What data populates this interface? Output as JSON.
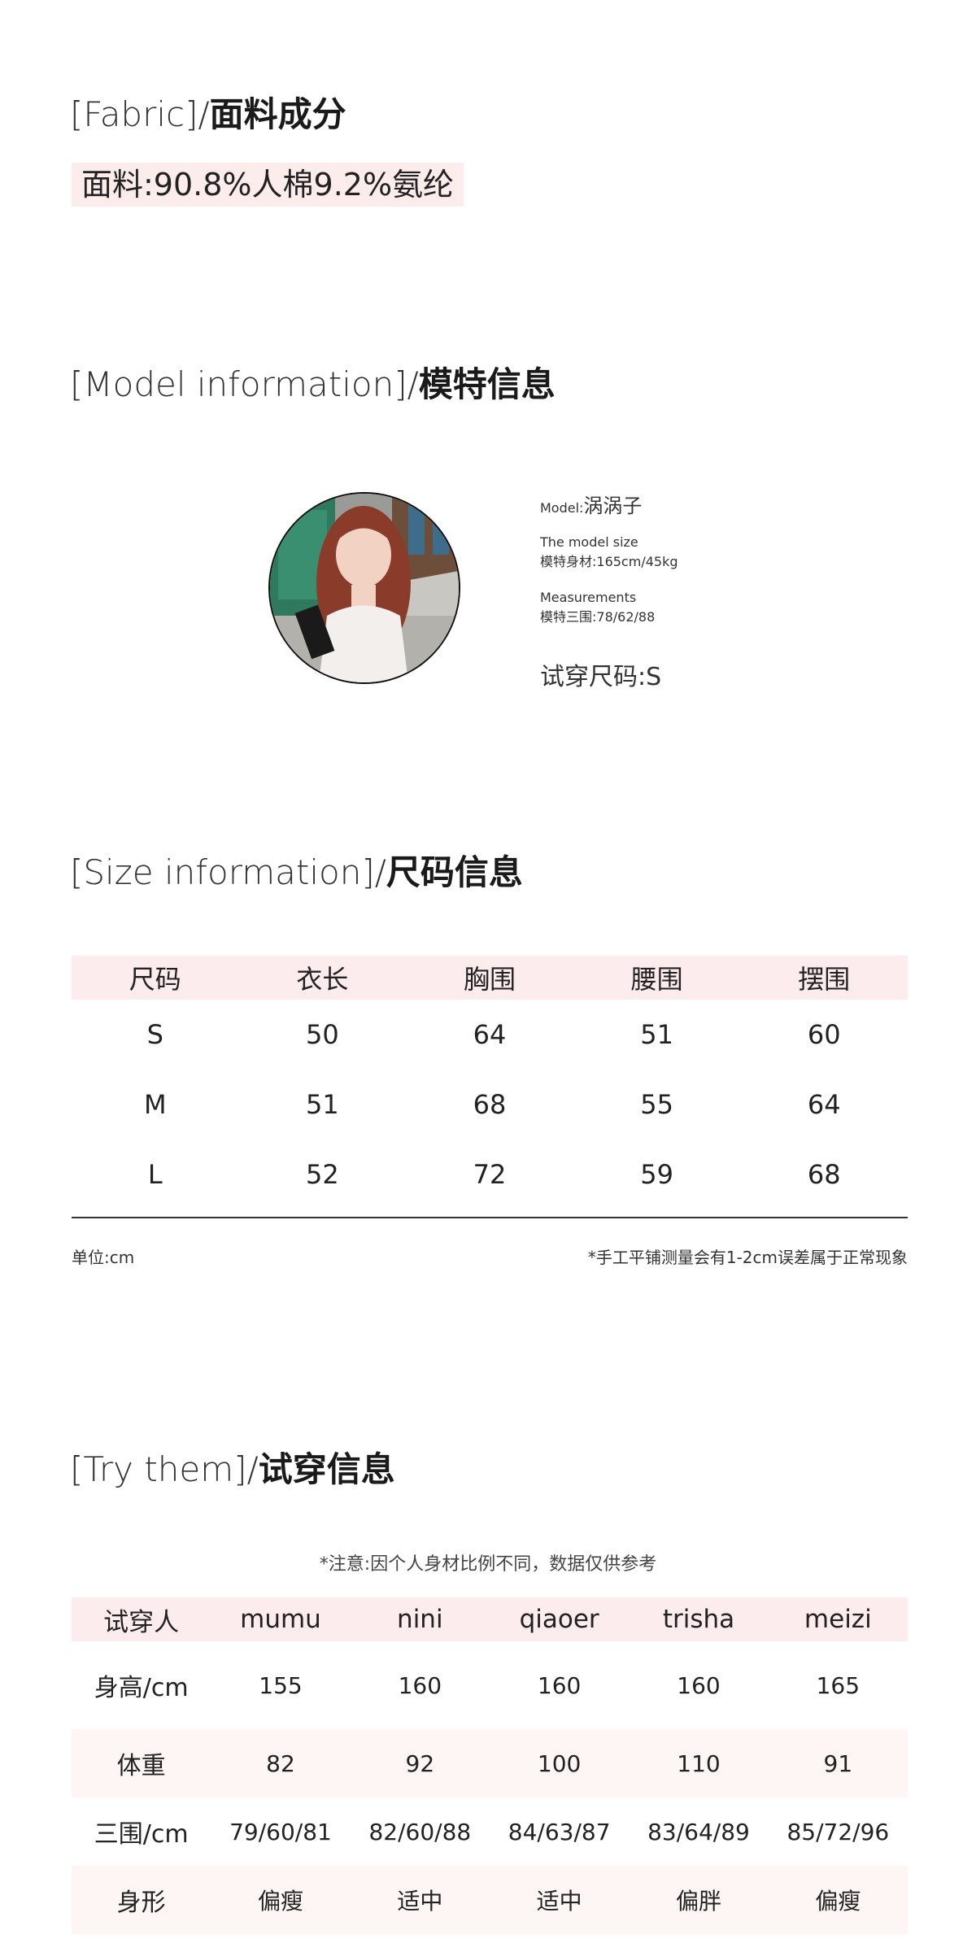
{
  "fabric": {
    "title_en": "[Fabric]/",
    "title_zh": "面料成分",
    "composition": "面料:90.8%人棉9.2%氨纶"
  },
  "model": {
    "title_en": "[Model information]/",
    "title_zh": "模特信息",
    "name_label": "Model:",
    "name": "涡涡子",
    "size_label_en": "The model size",
    "size_value": "模特身材:165cm/45kg",
    "measure_label_en": "Measurements",
    "measure_value": "模特三围:78/62/88",
    "fit_size": "试穿尺码:S"
  },
  "size_info": {
    "title_en": "[Size information]/",
    "title_zh": "尺码信息",
    "headers": [
      "尺码",
      "衣长",
      "胸围",
      "腰围",
      "摆围"
    ],
    "rows": [
      [
        "S",
        "50",
        "64",
        "51",
        "60"
      ],
      [
        "M",
        "51",
        "68",
        "55",
        "64"
      ],
      [
        "L",
        "52",
        "72",
        "59",
        "68"
      ]
    ],
    "unit": "单位:cm",
    "note": "*手工平铺测量会有1-2cm误差属于正常现象"
  },
  "try_info": {
    "title_en": "[Try them]/",
    "title_zh": "试穿信息",
    "note": "*注意:因个人身材比例不同，数据仅供参考",
    "headers": [
      "试穿人",
      "mumu",
      "nini",
      "qiaoer",
      "trisha",
      "meizi"
    ],
    "rows": [
      [
        "身高/cm",
        "155",
        "160",
        "160",
        "160",
        "165"
      ],
      [
        "体重",
        "82",
        "92",
        "100",
        "110",
        "91"
      ],
      [
        "三围/cm",
        "79/60/81",
        "82/60/88",
        "84/63/87",
        "83/64/89",
        "85/72/96"
      ],
      [
        "身形",
        "偏瘦",
        "适中",
        "适中",
        "偏胖",
        "偏瘦"
      ]
    ]
  },
  "colors": {
    "pink_band": "#fdeced",
    "light_band": "#fdf6f5",
    "text": "#222222"
  }
}
